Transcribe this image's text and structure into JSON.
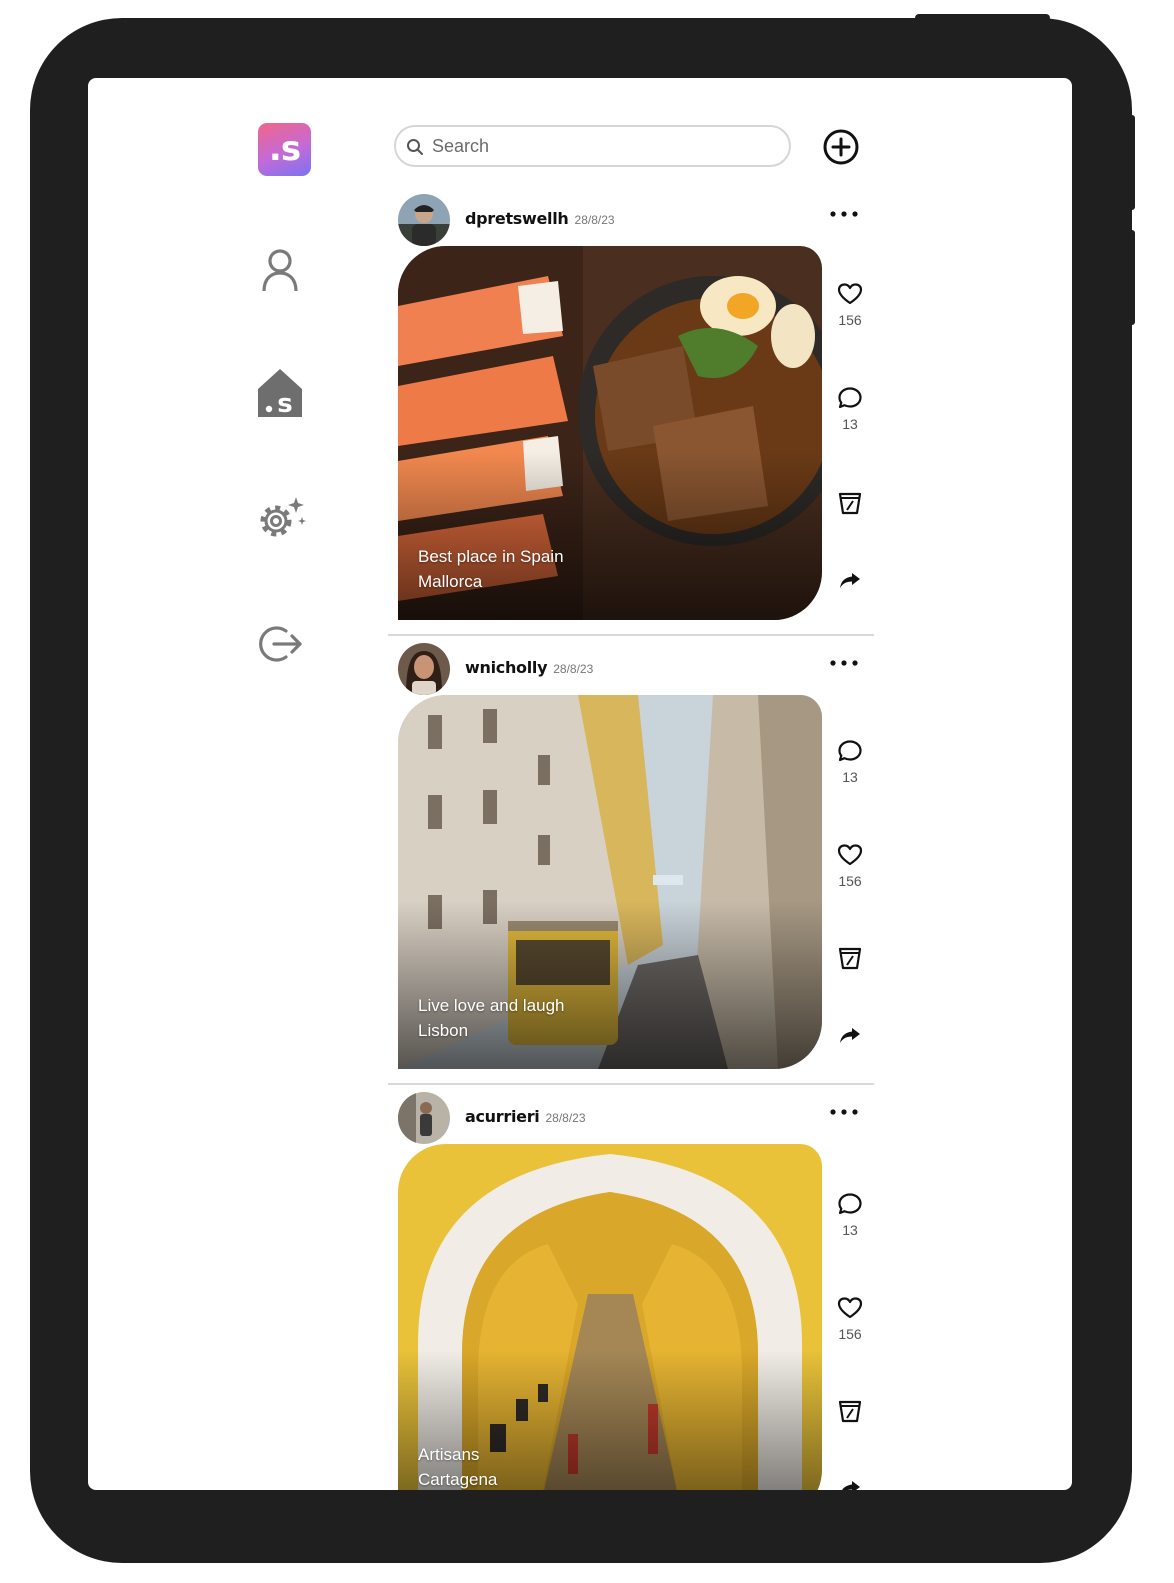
{
  "app": {
    "logo_text": ".s",
    "brand_gradient": [
      "#f0668a",
      "#c36ad8",
      "#7a73f2"
    ]
  },
  "sidebar": {
    "items": [
      {
        "name": "profile",
        "icon": "user-icon"
      },
      {
        "name": "home",
        "icon": "home-icon"
      },
      {
        "name": "settings",
        "icon": "gear-icon"
      },
      {
        "name": "logout",
        "icon": "logout-icon"
      }
    ]
  },
  "search": {
    "placeholder": "Search",
    "value": ""
  },
  "header": {
    "add_icon": "plus-circle-icon"
  },
  "posts": [
    {
      "username": "dpretswellh",
      "date": "28/8/23",
      "caption_line1": "Best place in Spain",
      "caption_line2": "Mallorca",
      "likes": "156",
      "comments": "13"
    },
    {
      "username": "wnicholly",
      "date": "28/8/23",
      "caption_line1": "Live love and laugh",
      "caption_line2": "Lisbon",
      "likes": "156",
      "comments": "13"
    },
    {
      "username": "acurrieri",
      "date": "28/8/23",
      "caption_line1": "Artisans",
      "caption_line2": "Cartagena",
      "likes": "156",
      "comments": "13"
    }
  ]
}
